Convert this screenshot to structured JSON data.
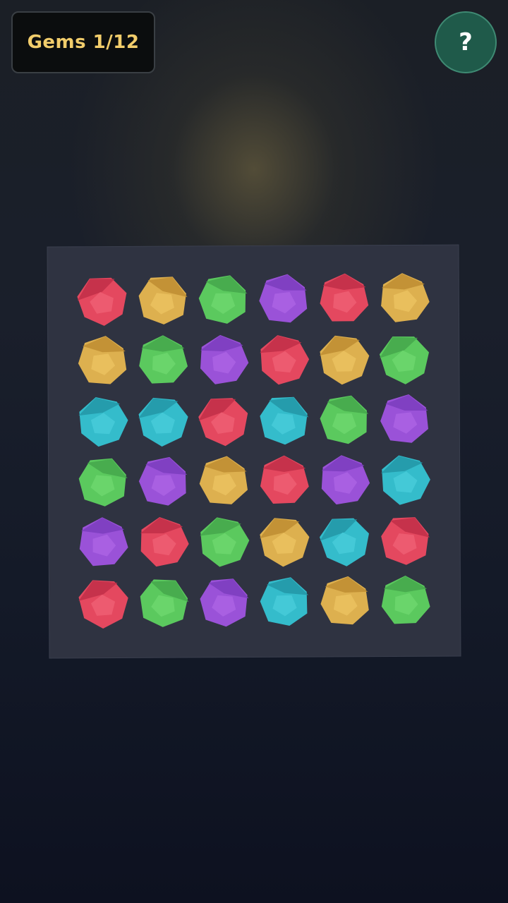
{
  "hud": {
    "counter_label": "Gems 1/12",
    "help_label": "?"
  },
  "palette": {
    "red": {
      "fill": "#e4485f",
      "top": "#c23049",
      "light": "#f06176"
    },
    "yellow": {
      "fill": "#ddb04f",
      "top": "#c08f33",
      "light": "#ecc462"
    },
    "green": {
      "fill": "#5bc95e",
      "top": "#46a84c",
      "light": "#6fd870"
    },
    "purple": {
      "fill": "#9a52d8",
      "top": "#7d3ec0",
      "light": "#ad66e6"
    },
    "cyan": {
      "fill": "#34bccb",
      "top": "#2398a8",
      "light": "#4acedb"
    }
  },
  "board": {
    "rows": 6,
    "cols": 6,
    "grid": [
      [
        "red",
        "yellow",
        "green",
        "purple",
        "red",
        "yellow"
      ],
      [
        "yellow",
        "green",
        "purple",
        "red",
        "yellow",
        "green"
      ],
      [
        "cyan",
        "cyan",
        "red",
        "cyan",
        "green",
        "purple"
      ],
      [
        "green",
        "purple",
        "yellow",
        "red",
        "purple",
        "cyan"
      ],
      [
        "purple",
        "red",
        "green",
        "yellow",
        "cyan",
        "red"
      ],
      [
        "red",
        "green",
        "purple",
        "cyan",
        "yellow",
        "green"
      ]
    ]
  }
}
